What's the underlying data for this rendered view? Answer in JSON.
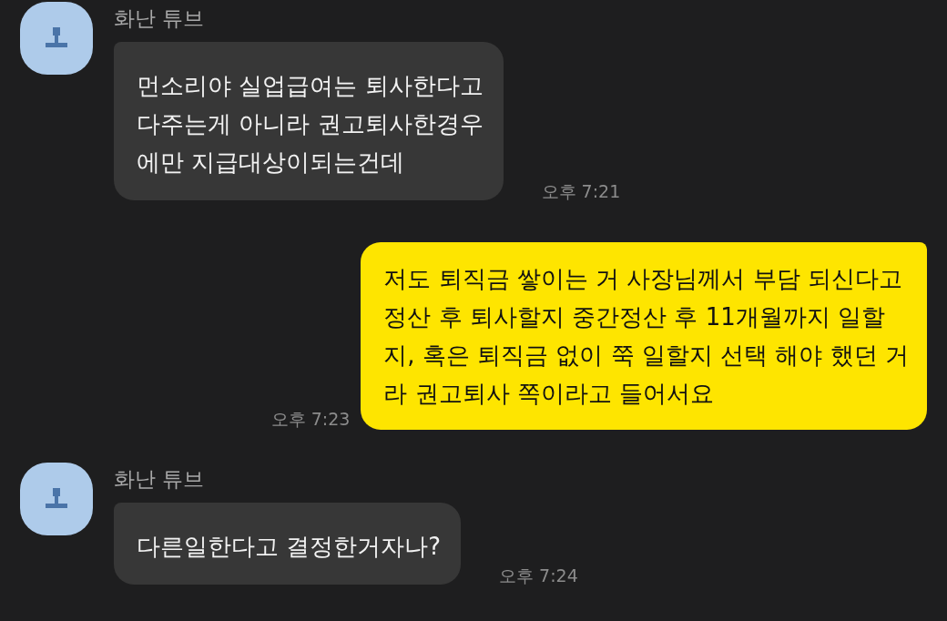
{
  "messages": [
    {
      "kind": "received",
      "sender": "화난 튜브",
      "text": "먼소리야 실업급여는 퇴사한다고\n다주는게 아니라 권고퇴사한경우\n에만 지급대상이되는건데",
      "time": "오후 7:21"
    },
    {
      "kind": "sent",
      "text": "저도 퇴직금 쌓이는 거 사장님께서 부담 되신다고\n정산 후 퇴사할지 중간정산 후 11개월까지 일할\n지, 혹은 퇴직금 없이 쭉 일할지 선택 해야 했던 거\n라 권고퇴사 쪽이라고 들어서요",
      "time": "오후 7:23"
    },
    {
      "kind": "received",
      "sender": "화난 튜브",
      "text": "다른일한다고 결정한거자나?",
      "time": "오후 7:24"
    }
  ]
}
